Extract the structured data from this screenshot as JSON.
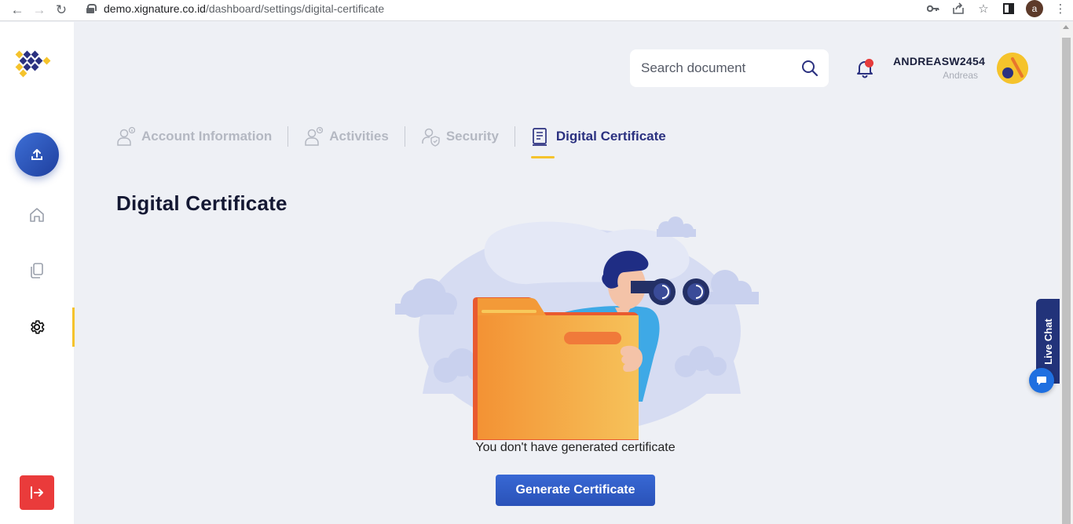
{
  "browser": {
    "url_domain": "demo.xignature.co.id",
    "url_path": "/dashboard/settings/digital-certificate",
    "profile_initial": "a"
  },
  "header": {
    "search_placeholder": "Search document",
    "username": "ANDREASW2454",
    "display_name": "Andreas"
  },
  "tabs": [
    {
      "label": "Account Information",
      "icon": "user-info-icon",
      "active": false
    },
    {
      "label": "Activities",
      "icon": "user-activity-icon",
      "active": false
    },
    {
      "label": "Security",
      "icon": "user-shield-icon",
      "active": false
    },
    {
      "label": "Digital Certificate",
      "icon": "certificate-icon",
      "active": true
    }
  ],
  "main": {
    "title": "Digital Certificate",
    "empty_message": "You don't have generated certificate",
    "generate_button": "Generate Certificate"
  },
  "live_chat": {
    "label": "Live Chat"
  },
  "colors": {
    "primary": "#2b52b8",
    "accent": "#f5c32c",
    "logout": "#ea3b3b",
    "navy": "#22337a"
  }
}
